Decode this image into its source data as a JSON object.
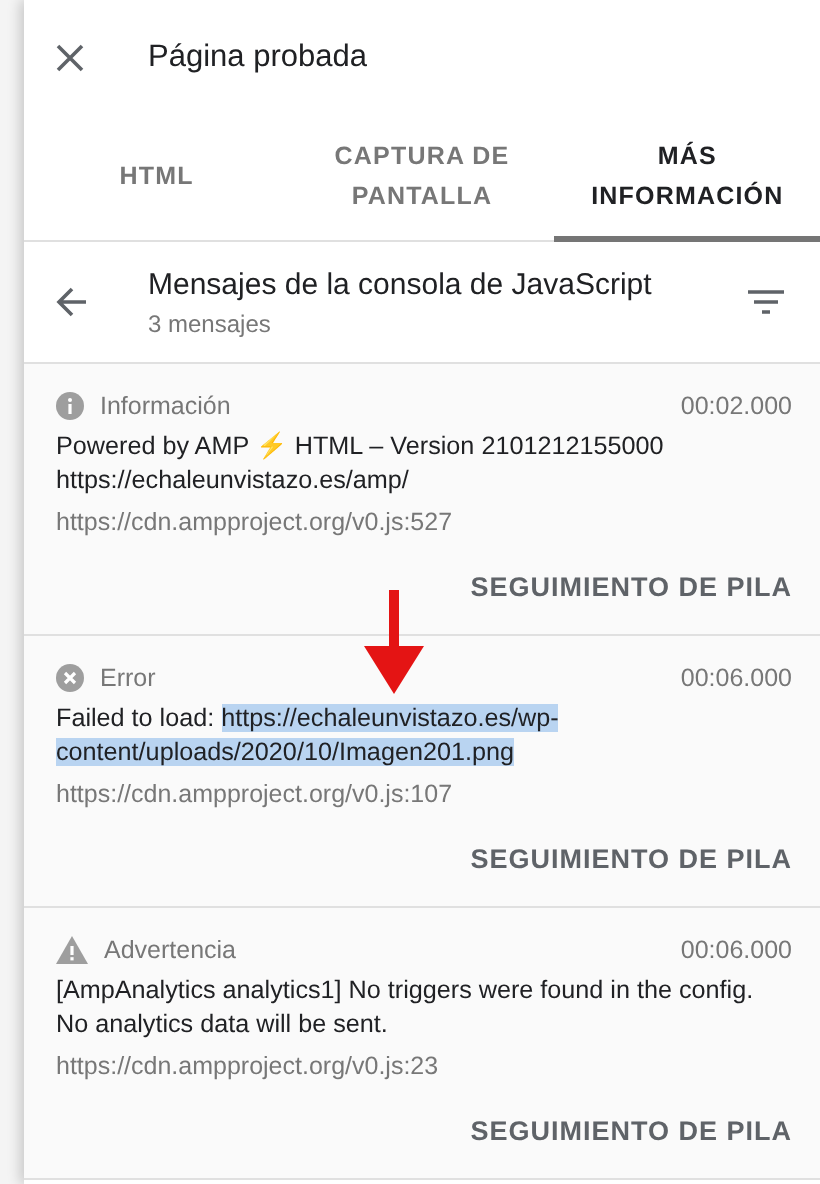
{
  "header": {
    "title": "Página probada"
  },
  "tabs": [
    {
      "label": "HTML",
      "selected": false
    },
    {
      "label": "CAPTURA DE PANTALLA",
      "selected": false
    },
    {
      "label": "MÁS INFORMACIÓN",
      "selected": true
    }
  ],
  "section": {
    "title": "Mensajes de la consola de JavaScript",
    "subtitle": "3 mensajes"
  },
  "messages": [
    {
      "kind": "info",
      "level_label": "Información",
      "time": "00:02.000",
      "text": "Powered by AMP ⚡ HTML – Version 2101212155000 https://echaleunvistazo.es/amp/",
      "source": "https://cdn.ampproject.org/v0.js:527",
      "action": "SEGUIMIENTO DE PILA"
    },
    {
      "kind": "error",
      "level_label": "Error",
      "time": "00:06.000",
      "text": "Failed to load:",
      "highlighted": "https://echaleunvistazo.es/wp-content/uploads/2020/10/Imagen201.png",
      "source": "https://cdn.ampproject.org/v0.js:107",
      "action": "SEGUIMIENTO DE PILA"
    },
    {
      "kind": "warning",
      "level_label": "Advertencia",
      "time": "00:06.000",
      "text": "[AmpAnalytics analytics1] No triggers were found in the config. No analytics data will be sent.",
      "source": "https://cdn.ampproject.org/v0.js:23",
      "action": "SEGUIMIENTO DE PILA"
    }
  ]
}
